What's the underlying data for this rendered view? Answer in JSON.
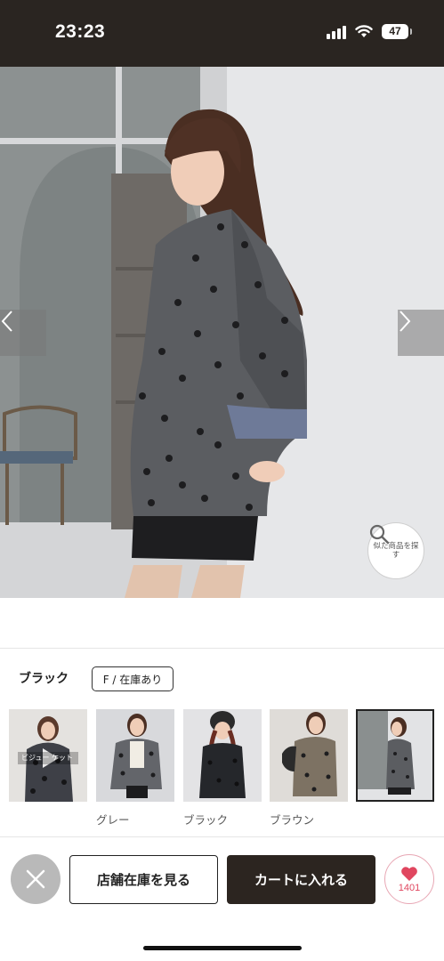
{
  "status_bar": {
    "time": "23:23",
    "battery": "47",
    "icons": [
      "signal-icon",
      "wifi-icon",
      "battery-icon"
    ]
  },
  "hero": {
    "prev_icon": "chevron-left-icon",
    "next_icon": "chevron-right-icon",
    "similar_label": "似た商品を探す",
    "similar_icon": "search-icon"
  },
  "product": {
    "color_name": "ブラック",
    "stock_badge": "F / 在庫あり"
  },
  "thumbnails": [
    {
      "label": "",
      "overlay_text": "ビジュー ケット",
      "is_video": true,
      "selected": false
    },
    {
      "label": "グレー",
      "selected": false
    },
    {
      "label": "ブラック",
      "selected": false
    },
    {
      "label": "ブラウン",
      "selected": false
    },
    {
      "label": "",
      "selected": true
    }
  ],
  "actions": {
    "close_icon": "close-icon",
    "store_stock_label": "店舗在庫を見る",
    "add_to_cart_label": "カートに入れる",
    "favorite_icon": "heart-icon",
    "favorite_count": "1401"
  },
  "colors": {
    "status_bar_bg": "#2a2521",
    "cart_button_bg": "#2c2520",
    "favorite_accent": "#e0465f"
  }
}
